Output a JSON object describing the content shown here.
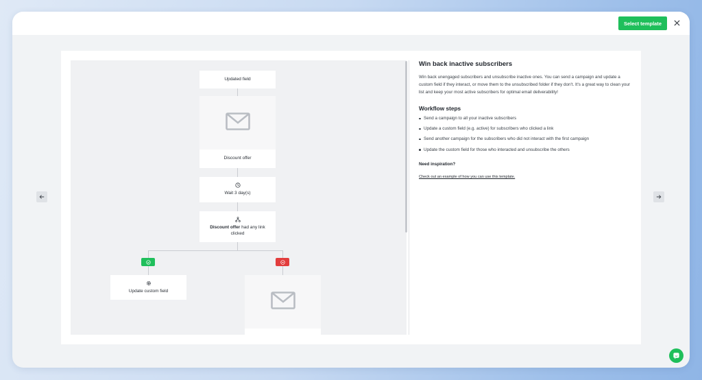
{
  "header": {
    "select_button": "Select template"
  },
  "workflow": {
    "nodes": {
      "updated_field": "Updated field",
      "discount_offer": "Discount offer",
      "wait": "Wait 3 day(s)",
      "condition_bold": "Discount offer",
      "condition_rest": " had any link clicked",
      "update_custom_field": "Update custom field"
    }
  },
  "panel": {
    "title": "Win back inactive subscribers",
    "description": "Win back unengaged subscribers and unsubscribe inactive ones. You can send a campaign and update a custom field if they interact, or move them to the unsubscribed folder if they don't. It's a great way to clean your list and keep your most active subscribers for optimal email deliverability!",
    "steps_title": "Workflow steps",
    "steps": [
      "Send a campaign to all your inactive subscribers",
      "Update a custom field (e.g. active) for subscribers who clicked a link",
      "Send another campaign for the subscribers who did not interact with the first campaign",
      "Update the custom field for those who interacted and unsubscribe the others"
    ],
    "inspiration_title": "Need inspiration?",
    "inspiration_link": "Check out an example of how you can use this template."
  },
  "colors": {
    "accent_green": "#1fbf5b",
    "danger_red": "#e23d3d"
  },
  "icons": {
    "close": "close-icon",
    "prev": "arrow-left-icon",
    "next": "arrow-right-icon",
    "email": "envelope-icon",
    "wait": "clock-icon",
    "condition": "branch-icon",
    "custom_field": "gear-icon",
    "yes": "check-icon",
    "no": "minus-icon",
    "chat": "chat-icon"
  }
}
